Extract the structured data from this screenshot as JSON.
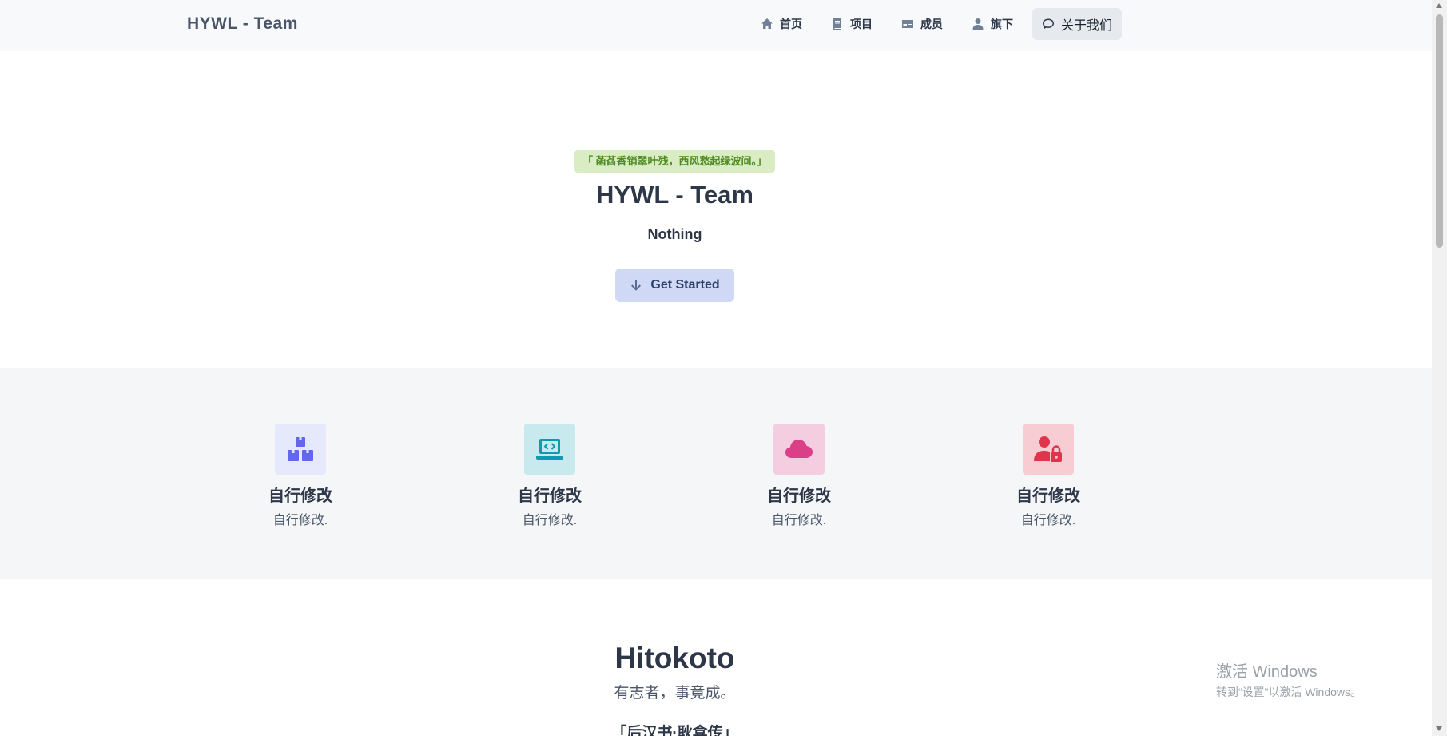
{
  "nav": {
    "brand": "HYWL - Team",
    "items": [
      {
        "label": "首页",
        "icon": "home-icon"
      },
      {
        "label": "项目",
        "icon": "book-icon"
      },
      {
        "label": "成员",
        "icon": "id-card-icon"
      },
      {
        "label": "旗下",
        "icon": "user-icon"
      },
      {
        "label": "关于我们",
        "icon": "comment-icon",
        "active": true
      }
    ]
  },
  "hero": {
    "quote": "「 菡萏香销翠叶残，西风愁起绿波间。」",
    "title": "HYWL - Team",
    "subtitle": "Nothing",
    "cta_label": "Get Started"
  },
  "features": [
    {
      "title": "自行修改",
      "desc": "自行修改.",
      "icon": "boxes-icon",
      "bg": "#e6e8fb",
      "color": "#6366f1"
    },
    {
      "title": "自行修改",
      "desc": "自行修改.",
      "icon": "laptop-code-icon",
      "bg": "#c8eaee",
      "color": "#0e9bb0"
    },
    {
      "title": "自行修改",
      "desc": "自行修改.",
      "icon": "cloud-icon",
      "bg": "#f4cde1",
      "color": "#db3f87"
    },
    {
      "title": "自行修改",
      "desc": "自行修改.",
      "icon": "user-lock-icon",
      "bg": "#f7cdd3",
      "color": "#e0344c"
    }
  ],
  "hitokoto": {
    "title": "Hitokoto",
    "text": "有志者，事竟成。",
    "source": "「后汉书·耿弇传」"
  },
  "watermark": {
    "line1": "激活 Windows",
    "line2": "转到“设置”以激活 Windows。"
  }
}
